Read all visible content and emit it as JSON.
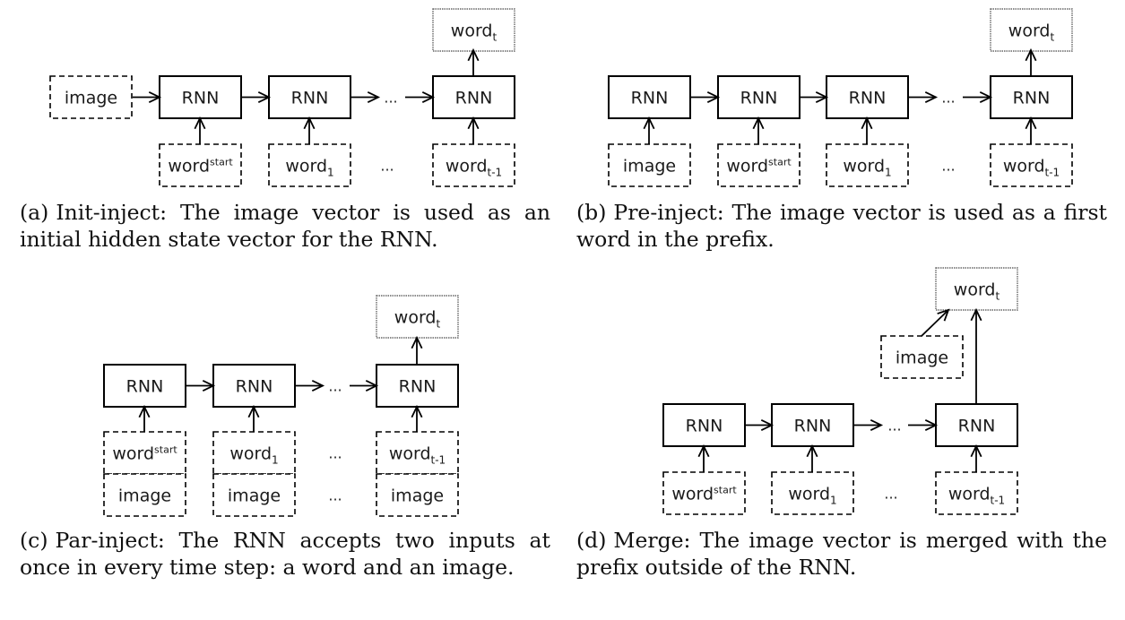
{
  "figure": {
    "panels": [
      {
        "id": "a",
        "name": "init-inject",
        "caption_tag": "(a)",
        "caption_text": "Init-inject: The image vector is used as an initial hidden state vector for the RNN."
      },
      {
        "id": "b",
        "name": "pre-inject",
        "caption_tag": "(b)",
        "caption_text": "Pre-inject: The image vector is used as a first word in the prefix."
      },
      {
        "id": "c",
        "name": "par-inject",
        "caption_tag": "(c)",
        "caption_text": "Par-inject: The RNN accepts two inputs at once in every time step: a word and an image."
      },
      {
        "id": "d",
        "name": "merge",
        "caption_tag": "(d)",
        "caption_text": "Merge: The image vector is merged with the prefix outside of the RNN."
      }
    ],
    "labels": {
      "rnn": "RNN",
      "image": "image",
      "word": "word",
      "start_sup": "start",
      "sub_1": "1",
      "sub_t": "t",
      "sub_t_minus_1": "t-1",
      "ellipsis": "..."
    }
  }
}
